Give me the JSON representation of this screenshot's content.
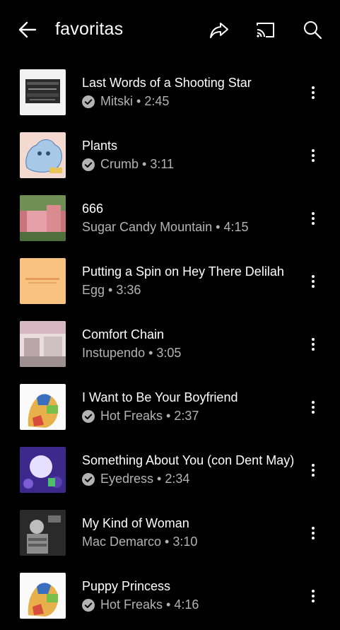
{
  "header": {
    "title": "favoritas",
    "icons": {
      "back": "back-arrow-icon",
      "share": "share-icon",
      "cast": "cast-icon",
      "search": "search-icon"
    }
  },
  "colors": {
    "background": "#000000",
    "primary_text": "#ffffff",
    "secondary_text": "#b3b3b3"
  },
  "songs": [
    {
      "title": "Last Words of a Shooting Star",
      "artist": "Mitski",
      "duration": "2:45",
      "verified": true
    },
    {
      "title": "Plants",
      "artist": "Crumb",
      "duration": "3:11",
      "verified": true
    },
    {
      "title": "666",
      "artist": "Sugar Candy Mountain",
      "duration": "4:15",
      "verified": false
    },
    {
      "title": "Putting a Spin on Hey There Delilah",
      "artist": "Egg",
      "duration": "3:36",
      "verified": false
    },
    {
      "title": "Comfort Chain",
      "artist": "Instupendo",
      "duration": "3:05",
      "verified": false
    },
    {
      "title": "I Want to Be Your Boyfriend",
      "artist": "Hot Freaks",
      "duration": "2:37",
      "verified": true
    },
    {
      "title": "Something About You (con Dent May)",
      "artist": "Eyedress",
      "duration": "2:34",
      "verified": true
    },
    {
      "title": "My Kind of Woman",
      "artist": "Mac Demarco",
      "duration": "3:10",
      "verified": false
    },
    {
      "title": "Puppy Princess",
      "artist": "Hot Freaks",
      "duration": "4:16",
      "verified": true
    }
  ],
  "separator": " • "
}
